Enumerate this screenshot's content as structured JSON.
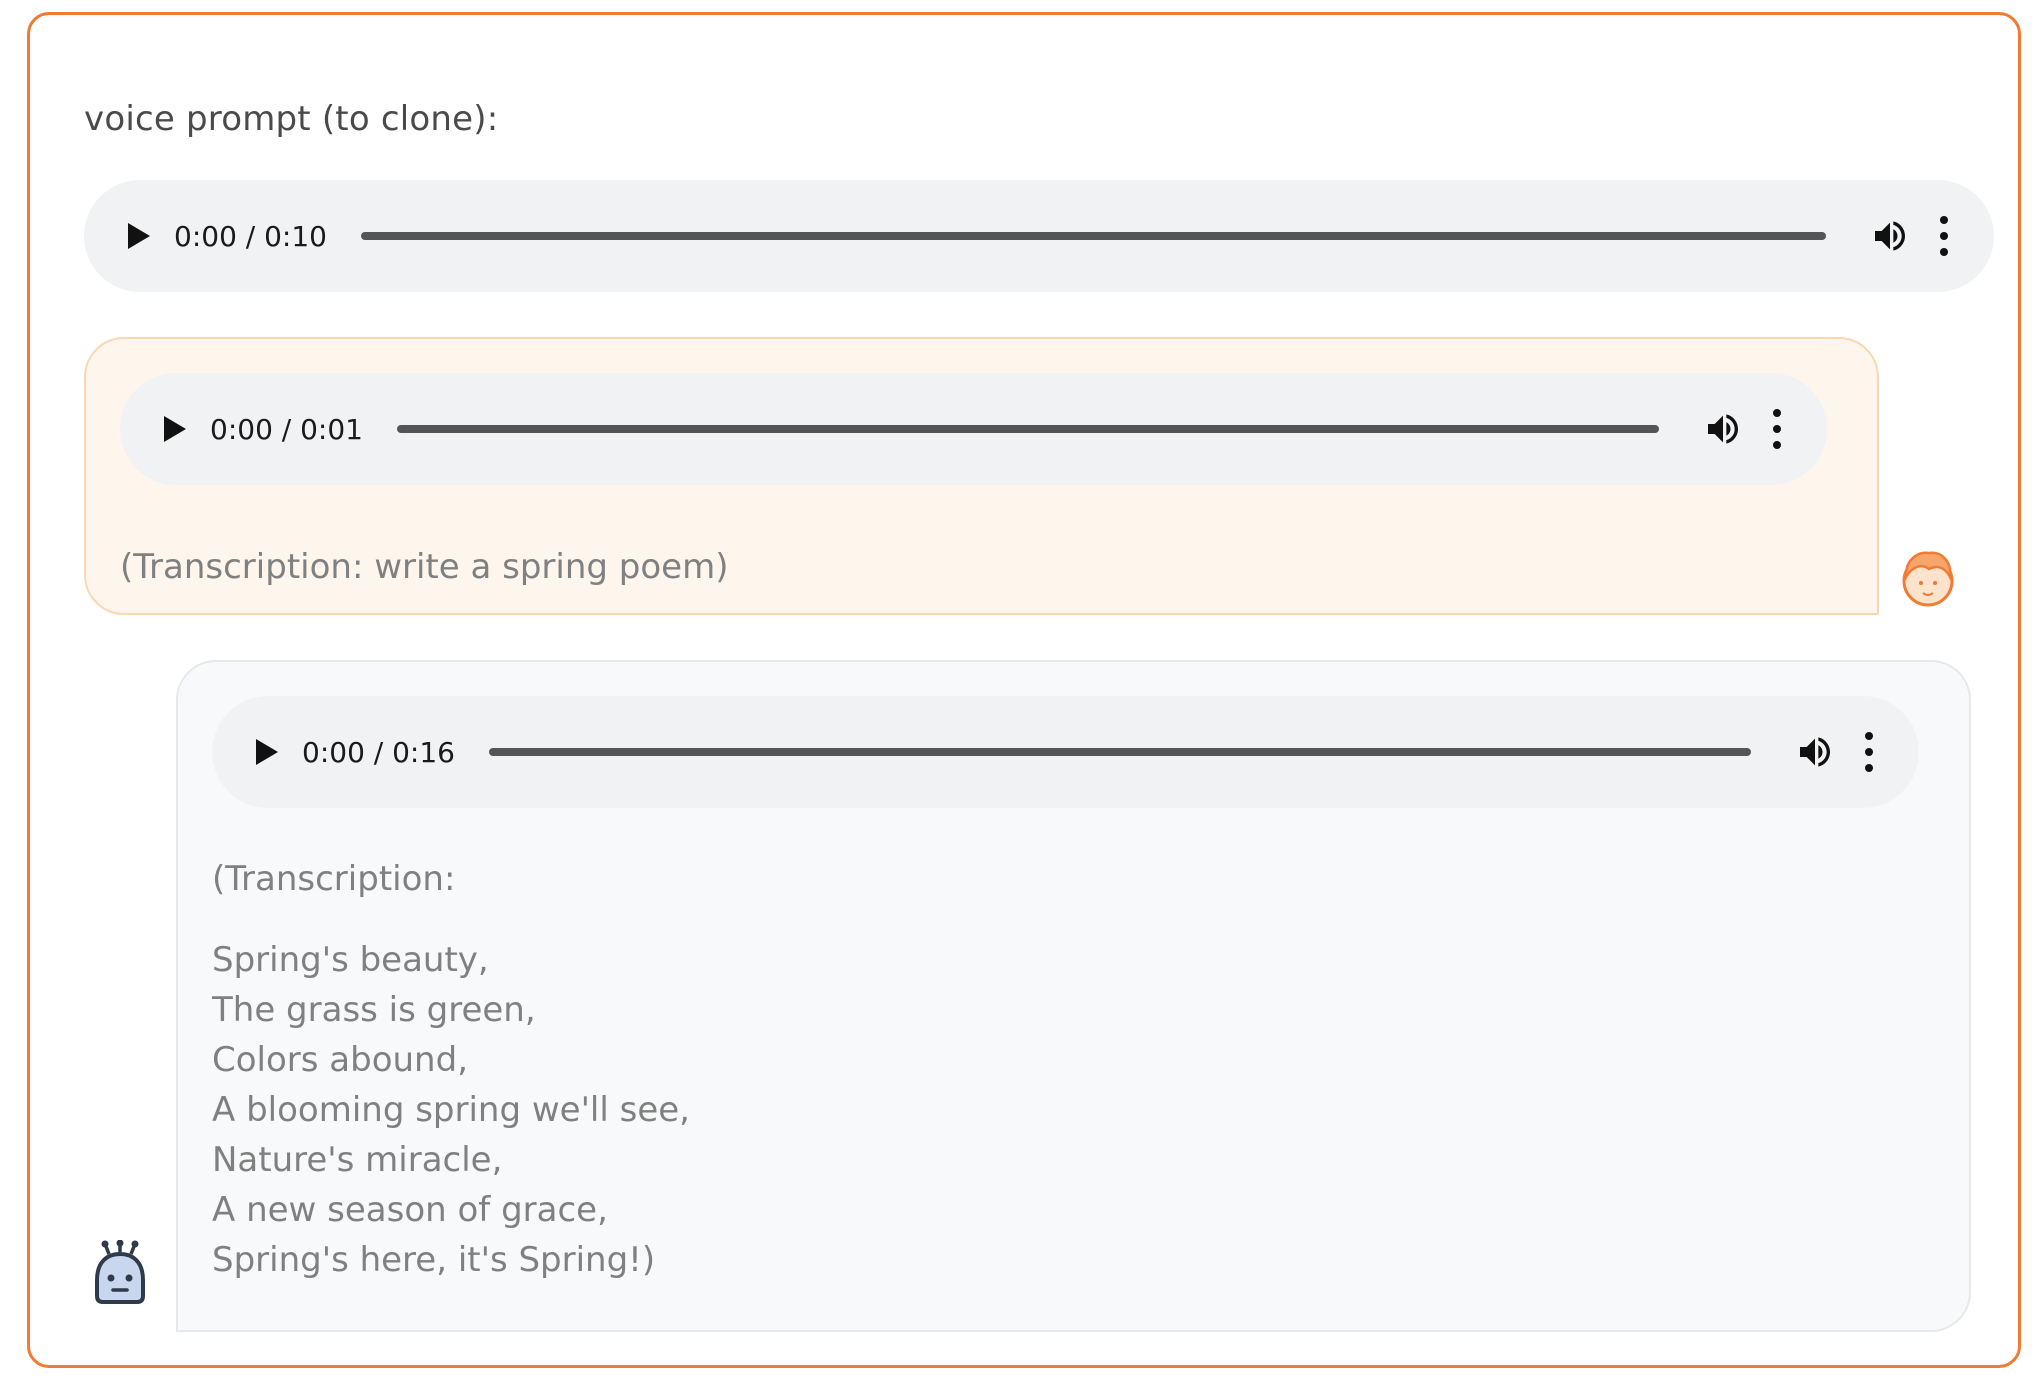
{
  "prompt": {
    "label": "voice prompt (to clone):",
    "player": {
      "time": "0:00 / 0:10"
    }
  },
  "user_message": {
    "player": {
      "time": "0:00 / 0:01"
    },
    "transcription": "(Transcription: write a spring poem)",
    "avatar_icon": "user-face-icon"
  },
  "bot_message": {
    "player": {
      "time": "0:00 / 0:16"
    },
    "transcription_header": "(Transcription:",
    "lines": [
      "Spring's beauty,",
      "The grass is green,",
      "Colors abound,",
      "A blooming spring we'll see,",
      "Nature's miracle,",
      "A new season of grace,",
      "Spring's here, it's Spring!)"
    ],
    "avatar_icon": "robot-icon"
  },
  "colors": {
    "frame_border": "#f27a33",
    "user_bubble_bg": "#fef5ec",
    "bot_bubble_bg": "#f8f9fb",
    "player_bg": "#f1f2f4"
  }
}
